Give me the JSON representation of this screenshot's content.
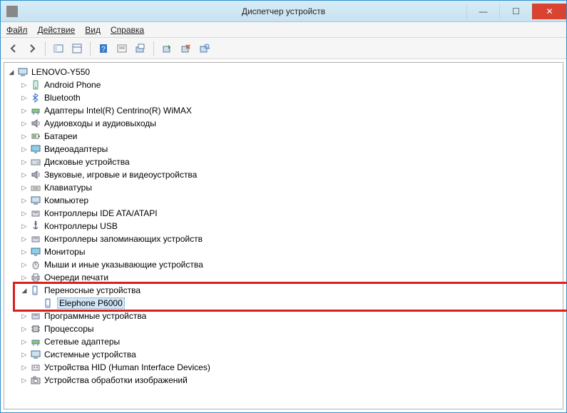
{
  "window": {
    "title": "Диспетчер устройств"
  },
  "menubar": {
    "file": "Файл",
    "action": "Действие",
    "view": "Вид",
    "help": "Справка"
  },
  "tree": {
    "root": {
      "label": "LENOVO-Y550"
    },
    "items": [
      {
        "label": "Android Phone"
      },
      {
        "label": "Bluetooth"
      },
      {
        "label": "Адаптеры Intel(R) Centrino(R) WiMAX"
      },
      {
        "label": "Аудиовходы и аудиовыходы"
      },
      {
        "label": "Батареи"
      },
      {
        "label": "Видеоадаптеры"
      },
      {
        "label": "Дисковые устройства"
      },
      {
        "label": "Звуковые, игровые и видеоустройства"
      },
      {
        "label": "Клавиатуры"
      },
      {
        "label": "Компьютер"
      },
      {
        "label": "Контроллеры IDE ATA/ATAPI"
      },
      {
        "label": "Контроллеры USB"
      },
      {
        "label": "Контроллеры запоминающих устройств"
      },
      {
        "label": "Мониторы"
      },
      {
        "label": "Мыши и иные указывающие устройства"
      },
      {
        "label": "Очереди печати"
      },
      {
        "label": "Переносные устройства",
        "expanded": true,
        "children": [
          {
            "label": "Elephone P6000",
            "selected": true
          }
        ]
      },
      {
        "label": "Программные устройства"
      },
      {
        "label": "Процессоры"
      },
      {
        "label": "Сетевые адаптеры"
      },
      {
        "label": "Системные устройства"
      },
      {
        "label": "Устройства HID (Human Interface Devices)"
      },
      {
        "label": "Устройства обработки изображений"
      }
    ]
  }
}
